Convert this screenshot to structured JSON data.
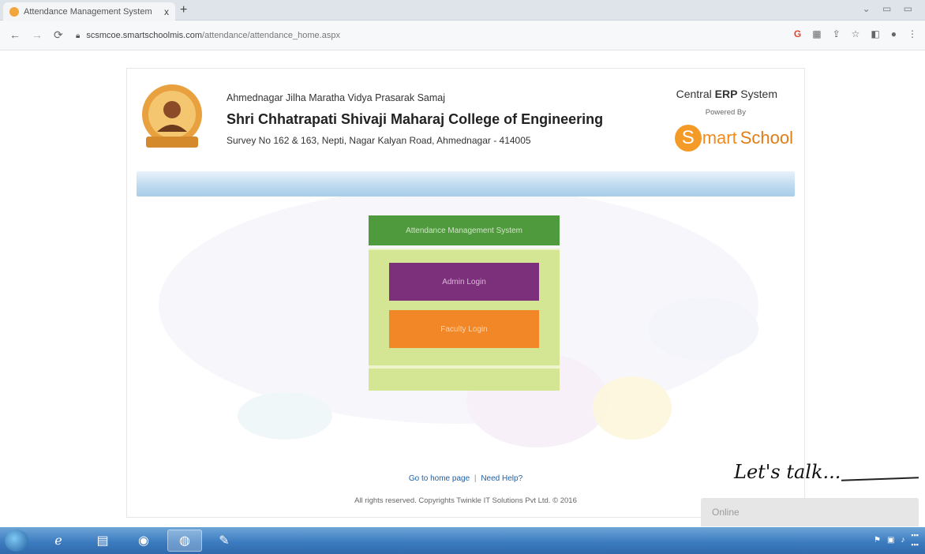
{
  "browser": {
    "tab_title": "Attendance Management System",
    "tab_close": "x",
    "new_tab": "+",
    "url_domain": "scsmcoe.smartschoolmis.com",
    "url_path": "/attendance/attendance_home.aspx"
  },
  "header": {
    "society": "Ahmednagar Jilha Maratha Vidya Prasarak Samaj",
    "college": "Shri Chhatrapati Shivaji Maharaj College of Engineering",
    "address": "Survey No 162 & 163, Nepti, Nagar Kalyan Road, Ahmednagar - 414005",
    "erp_prefix": "Central ",
    "erp_bold": "ERP",
    "erp_suffix": " System",
    "powered_by": "Powered By",
    "brand_s": "S",
    "brand_mart": "mart",
    "brand_school": "School"
  },
  "ams": {
    "title": "Attendance Management System",
    "admin_button": "Admin Login",
    "faculty_button": "Faculty Login"
  },
  "footer": {
    "home_link": "Go to home page",
    "separator": "|",
    "help_link": "Need Help?",
    "copyright": "All rights reserved. Copyrights Twinkle IT Solutions Pvt Ltd. © 2016"
  },
  "chat": {
    "talk": "Let's talk...",
    "status": "Online"
  },
  "colors": {
    "ams_header": "#4f9a3d",
    "ams_panel": "#d4e593",
    "admin_button": "#7c2f7a",
    "faculty_button": "#f28728",
    "brand": "#f49a27"
  }
}
